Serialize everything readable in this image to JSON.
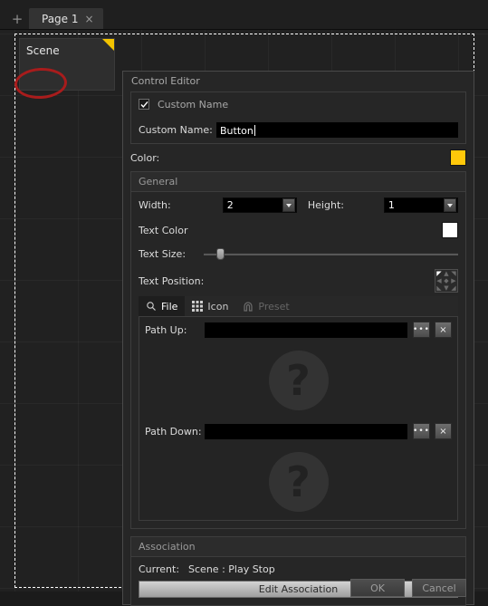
{
  "tabbar": {
    "new_tab_label": "+",
    "tabs": [
      {
        "label": "Page 1",
        "close_label": "×"
      }
    ]
  },
  "canvas": {
    "scene_control": {
      "label": "Scene",
      "corner_color": "#f2c300"
    },
    "annotation_color": "#a81c1c"
  },
  "dialog": {
    "title": "Control Editor",
    "custom_name_section": {
      "checkbox_label": "Custom Name",
      "checkbox_checked": true,
      "field_label": "Custom Name:",
      "field_value": "Button"
    },
    "color_row": {
      "label": "Color:",
      "swatch_color": "#ffc80a"
    },
    "general": {
      "title": "General",
      "width_label": "Width:",
      "width_value": "2",
      "height_label": "Height:",
      "height_value": "1",
      "text_color_label": "Text Color",
      "text_color_swatch": "#ffffff",
      "text_size_label": "Text Size:",
      "text_size_percent": 5,
      "text_position_label": "Text Position:",
      "text_position_selected": "top-left",
      "position_cells": [
        {
          "name": "top-left",
          "glyph": "◤",
          "selected": true
        },
        {
          "name": "top-center",
          "glyph": "▲",
          "selected": false
        },
        {
          "name": "top-right",
          "glyph": "◥",
          "selected": false
        },
        {
          "name": "middle-left",
          "glyph": "◀",
          "selected": false
        },
        {
          "name": "middle-center",
          "glyph": "◆",
          "selected": false
        },
        {
          "name": "middle-right",
          "glyph": "▶",
          "selected": false
        },
        {
          "name": "bottom-left",
          "glyph": "◣",
          "selected": false
        },
        {
          "name": "bottom-center",
          "glyph": "▼",
          "selected": false
        },
        {
          "name": "bottom-right",
          "glyph": "◢",
          "selected": false
        }
      ],
      "source_tabs": [
        {
          "label": "File",
          "icon": "magnifier-icon",
          "state": "active"
        },
        {
          "label": "Icon",
          "icon": "grid-icon",
          "state": "normal"
        },
        {
          "label": "Preset",
          "icon": "magnet-icon",
          "state": "disabled"
        }
      ],
      "path_up": {
        "label": "Path Up:",
        "value": "",
        "browse_label": "•••",
        "clear_label": "×",
        "preview_placeholder": "?"
      },
      "path_down": {
        "label": "Path Down:",
        "value": "",
        "browse_label": "•••",
        "clear_label": "×",
        "preview_placeholder": "?"
      }
    },
    "association": {
      "title": "Association",
      "current_label": "Current:",
      "current_value": "Scene : Play Stop",
      "edit_button_label": "Edit Association"
    },
    "footer": {
      "ok_label": "OK",
      "cancel_label": "Cancel"
    }
  }
}
